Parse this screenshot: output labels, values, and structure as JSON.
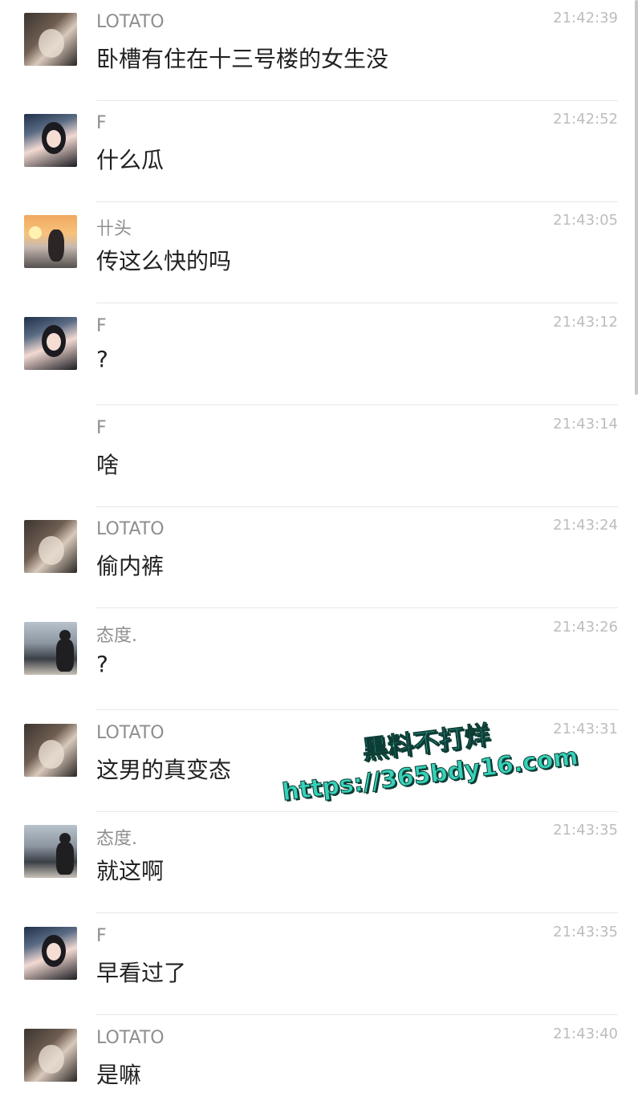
{
  "messages": [
    {
      "sender": "LOTATO",
      "time": "21:42:39",
      "text": "卧槽有住在十三号楼的女生没",
      "avatar": "lotato-avatar"
    },
    {
      "sender": "F",
      "time": "21:42:52",
      "text": "什么瓜",
      "avatar": "f-avatar"
    },
    {
      "sender": "卄头",
      "time": "21:43:05",
      "text": "传这么快的吗",
      "avatar": "shitou-avatar"
    },
    {
      "sender": "F",
      "time": "21:43:12",
      "text": "?",
      "avatar": "f-avatar"
    },
    {
      "sender": "F",
      "time": "21:43:14",
      "text": "啥",
      "avatar": ""
    },
    {
      "sender": "LOTATO",
      "time": "21:43:24",
      "text": "偷内裤",
      "avatar": "lotato-avatar"
    },
    {
      "sender": "态度.",
      "time": "21:43:26",
      "text": "?",
      "avatar": "taidu-avatar"
    },
    {
      "sender": "LOTATO",
      "time": "21:43:31",
      "text": "这男的真变态",
      "avatar": "lotato-avatar"
    },
    {
      "sender": "态度.",
      "time": "21:43:35",
      "text": "就这啊",
      "avatar": "taidu-avatar"
    },
    {
      "sender": "F",
      "time": "21:43:35",
      "text": "早看过了",
      "avatar": "f-avatar"
    },
    {
      "sender": "LOTATO",
      "time": "21:43:40",
      "text": "是嘛",
      "avatar": "lotato-avatar"
    }
  ],
  "watermark": {
    "line1": "黑料不打烊",
    "line2": "https://365bdy16.com"
  },
  "colors": {
    "sender": "#8e8e8e",
    "time": "#bdbdbd",
    "text": "#222222",
    "divider": "#e7e7e7",
    "watermark": "#36d1b8"
  }
}
